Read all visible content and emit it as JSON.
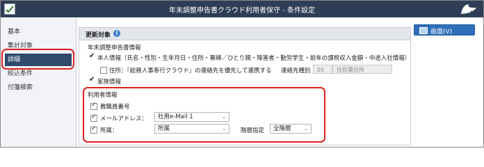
{
  "titlebar": {
    "title": "年末調整申告書クラウド利用者保守 - 条件設定"
  },
  "sidebar": {
    "items": [
      {
        "label": "基本"
      },
      {
        "label": "集計対象"
      },
      {
        "label": "詳細",
        "active": true
      },
      {
        "label": "絞込条件"
      },
      {
        "label": "付箋検索"
      }
    ]
  },
  "section": {
    "title": "更新対象",
    "group1_title": "年末調整申告書情報",
    "personal_info": "本人情報（氏名・性別・生年月日・住所・寡婦／ひとり親・障害者・勤労学生・前年の課税収入金額・中途入社情報）",
    "address_option": "住所：『総務人事奉行クラウド』の連絡先を優先して連携する",
    "contact_type_label": "連絡先種別",
    "contact_type_code": "05",
    "contact_type_name": "住民票住所",
    "family_info": "家族情報",
    "group2_title": "利用者情報",
    "employee_no": "教職員番号",
    "email_label": "メールアドレス：",
    "email_value": "社用e-Mail 1",
    "dept_label": "所属：",
    "dept_value": "所属",
    "level_label": "階層指定",
    "level_value": "全階層"
  },
  "right_button": {
    "label": "画面(V)"
  }
}
